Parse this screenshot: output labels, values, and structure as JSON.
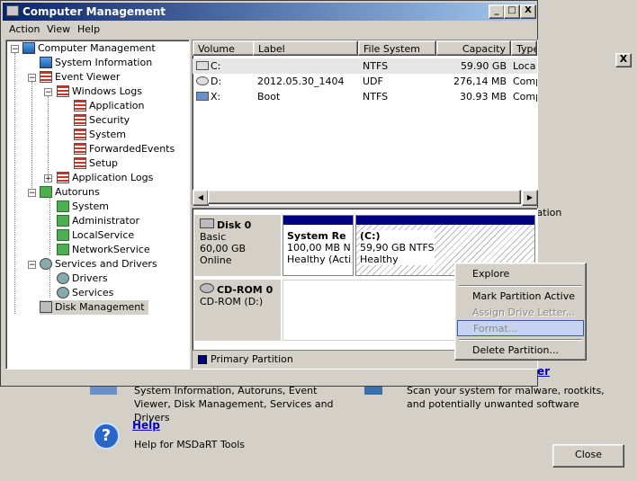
{
  "window": {
    "title": "Computer Management",
    "min_glyph": "_",
    "max_glyph": "□",
    "close_glyph": "X"
  },
  "menu": {
    "action": "Action",
    "view": "View",
    "help": "Help"
  },
  "tree": [
    {
      "label": "Computer Management",
      "icon": "computer-icon"
    },
    {
      "label": "System Information",
      "icon": "system-info-icon"
    },
    {
      "label": "Event Viewer",
      "icon": "event-viewer-icon"
    },
    {
      "label": "Windows Logs",
      "icon": "folder-icon"
    },
    {
      "label": "Application",
      "icon": "log-icon"
    },
    {
      "label": "Security",
      "icon": "log-icon"
    },
    {
      "label": "System",
      "icon": "log-icon"
    },
    {
      "label": "ForwardedEvents",
      "icon": "log-icon"
    },
    {
      "label": "Setup",
      "icon": "log-icon"
    },
    {
      "label": "Application Logs",
      "icon": "folder-icon"
    },
    {
      "label": "Autoruns",
      "icon": "autoruns-icon"
    },
    {
      "label": "System",
      "icon": "autoruns-icon"
    },
    {
      "label": "Administrator",
      "icon": "autoruns-icon"
    },
    {
      "label": "LocalService",
      "icon": "autoruns-icon"
    },
    {
      "label": "NetworkService",
      "icon": "autoruns-icon"
    },
    {
      "label": "Services and Drivers",
      "icon": "gears-icon"
    },
    {
      "label": "Drivers",
      "icon": "gear-icon"
    },
    {
      "label": "Services",
      "icon": "gear-icon"
    },
    {
      "label": "Disk Management",
      "icon": "disk-management-icon"
    }
  ],
  "volumes": {
    "columns": [
      "Volume",
      "Label",
      "File System",
      "Capacity",
      "Type"
    ],
    "rows": [
      {
        "volume": "C:",
        "label": "",
        "fs": "NTFS",
        "capacity": "59.90 GB",
        "type": "Loca"
      },
      {
        "volume": "D:",
        "label": "2012.05.30_1404",
        "fs": "UDF",
        "capacity": "276,14 MB",
        "type": "Comp"
      },
      {
        "volume": "X:",
        "label": "Boot",
        "fs": "NTFS",
        "capacity": "30.93 MB",
        "type": "Comp"
      }
    ],
    "scroll_left": "◀",
    "scroll_right": "▶"
  },
  "disks": {
    "disk0": {
      "name": "Disk 0",
      "kind": "Basic",
      "size": "60,00 GB",
      "status": "Online"
    },
    "sysres": {
      "name": "System Re",
      "size": "100,00 MB N",
      "health": "Healthy (Acti"
    },
    "c_part": {
      "name": "(C:)",
      "size": "59,90 GB NTFS",
      "health": "Healthy"
    },
    "cdrom": {
      "name": "CD-ROM 0",
      "device": "CD-ROM (D:)"
    },
    "legend": "Primary Partition",
    "legend_color": "#000080"
  },
  "context_menu": {
    "explore": "Explore",
    "mark_active": "Mark Partition Active",
    "assign_letter": "Assign Drive Letter...",
    "format": "Format...",
    "delete": "Delete Partition..."
  },
  "background": {
    "close_glyph": "X",
    "ration_fragment": "ration",
    "er_fragment": "er",
    "desc_left": "System Information, Autoruns, Event Viewer, Disk Management, Services and Drivers",
    "desc_right": "Scan your system for malware, rootkits, and potentially unwanted software",
    "help_link": "Help",
    "help_icon": "?",
    "help_desc": "Help for MSDaRT Tools",
    "close_button": "Close"
  }
}
